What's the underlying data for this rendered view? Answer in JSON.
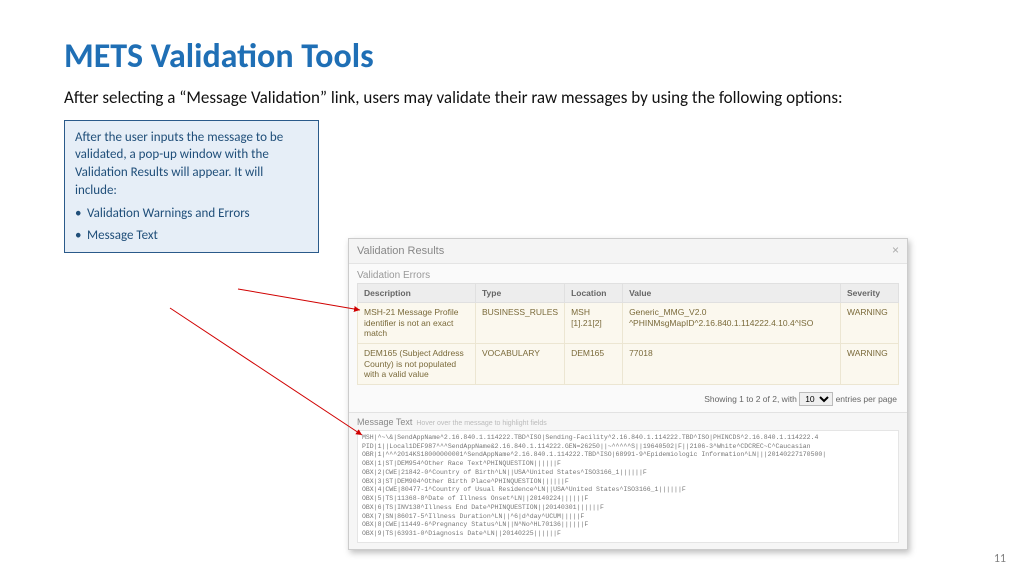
{
  "title": "METS Validation Tools",
  "intro": "After selecting a “Message Validation” link, users may validate their raw messages by using the following options:",
  "callout": {
    "lead": "After the user inputs the message to be validated, a pop-up window with the Validation Results will appear. It will include:",
    "bullets": [
      "Validation Warnings and Errors",
      "Message Text"
    ]
  },
  "popup": {
    "title": "Validation Results",
    "close": "×",
    "errors_label": "Validation Errors",
    "columns": [
      "Description",
      "Type",
      "Location",
      "Value",
      "Severity"
    ],
    "rows": [
      {
        "desc": "MSH-21 Message Profile identifier is not an exact match",
        "type": "BUSINESS_RULES",
        "loc": "MSH [1].21[2]",
        "value": "Generic_MMG_V2.0 ^PHINMsgMapID^2.16.840.1.114222.4.10.4^ISO",
        "sev": "WARNING"
      },
      {
        "desc": "DEM165 (Subject Address County) is not populated with a valid value",
        "type": "VOCABULARY",
        "loc": "DEM165",
        "value": "77018",
        "sev": "WARNING"
      }
    ],
    "pager_prefix": "Showing 1 to 2 of 2, with",
    "pager_select": "10",
    "pager_suffix": "entries per page",
    "msg_label": "Message Text",
    "msg_hint": "Hover over the message to highlight fields",
    "msg_lines": [
      "MSH|^~\\&|SendAppName^2.16.840.1.114222.TBD^ISO|Sending-Facility^2.16.840.1.114222.TBD^ISO|PHINCDS^2.16.840.1.114222.4",
      "PID|1||Local1DEF987^^^SendAppName&2.16.840.1.114222.GEN=26250||~^^^^^S||19640502|F||2106-3^White^CDCREC~C^Caucasian",
      "OBR|1|^^^2014KS18000000001^SendAppName^2.16.840.1.114222.TBD^ISO|68991-9^Epidemiologic Information^LN|||20140227170500|",
      "OBX|1|ST|DEM954^Other Race Text^PHINQUESTION||||||F",
      "OBX|2|CWE|21842-0^Country of Birth^LN||USA^United States^ISO3166_1||||||F",
      "OBX|3|ST|DEM904^Other Birth Place^PHINQUESTION||||||F",
      "OBX|4|CWE|80477-1^Country of Usual Residence^LN||USA^United States^ISO3166_1||||||F",
      "OBX|5|TS|11368-8^Date of Illness Onset^LN||20140224||||||F",
      "OBX|6|TS|INV138^Illness End Date^PHINQUESTION||20140301||||||F",
      "OBX|7|SN|86017-5^Illness Duration^LN||^6|d^day^UCUM|||||F",
      "OBX|8|CWE|11449-6^Pregnancy Status^LN||N^No^HL70136||||||F",
      "OBX|9|TS|63931-0^Diagnosis Date^LN||20140225||||||F"
    ]
  },
  "page_number": "11"
}
